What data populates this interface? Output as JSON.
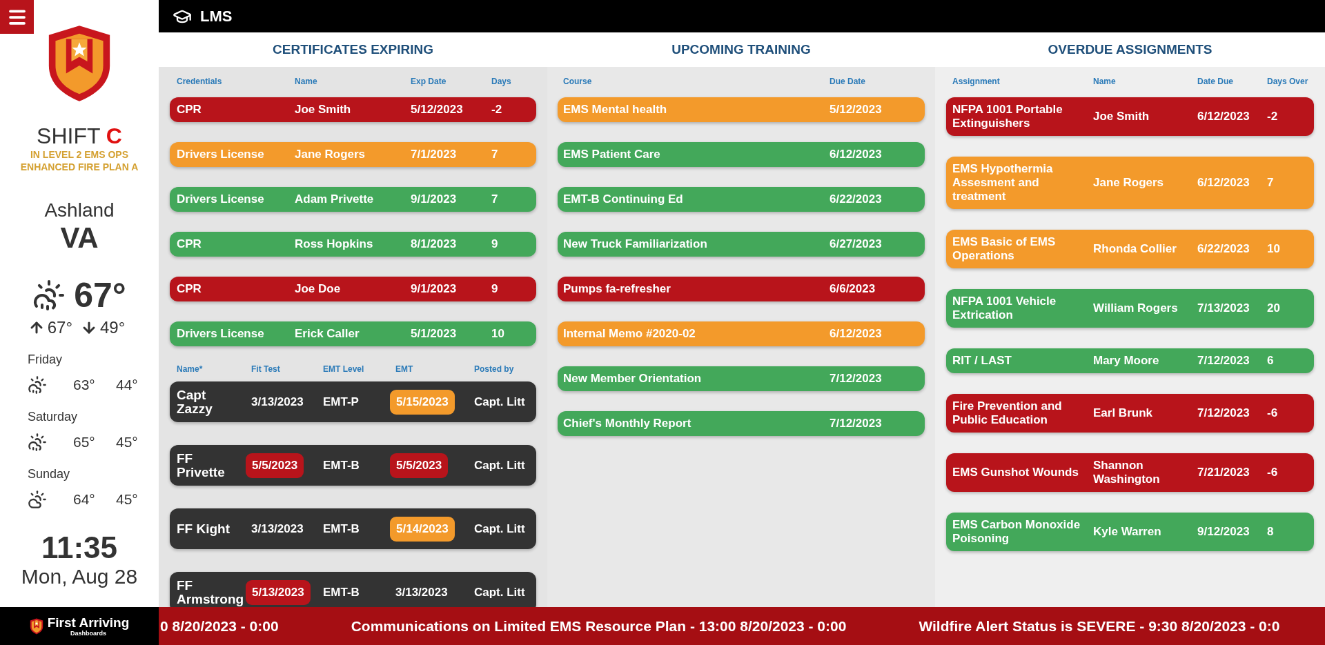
{
  "sidebar": {
    "shift": {
      "label": "SHIFT",
      "letter": "C"
    },
    "alert_lines": [
      "IN LEVEL 2 EMS OPS",
      "ENHANCED FIRE PLAN A"
    ],
    "city": "Ashland",
    "state": "VA",
    "weather": {
      "temperature": "67°",
      "high": "67°",
      "low": "49°"
    },
    "forecast": [
      {
        "day": "Friday",
        "kind": "rain",
        "high": "63°",
        "low": "44°"
      },
      {
        "day": "Saturday",
        "kind": "rain",
        "high": "65°",
        "low": "45°"
      },
      {
        "day": "Sunday",
        "kind": "cloudy",
        "high": "64°",
        "low": "45°"
      }
    ],
    "clock": {
      "time": "11:35",
      "date": "Mon, Aug 28"
    }
  },
  "header": {
    "title": "LMS"
  },
  "certificates": {
    "title": "CERTIFICATES EXPIRING",
    "columns": [
      "Credentials",
      "Name",
      "Exp Date",
      "Days"
    ],
    "rows": [
      {
        "color": "#b8141b",
        "cells": [
          "CPR",
          "Joe Smith",
          "5/12/2023",
          "-2"
        ]
      },
      {
        "color": "#f39a2b",
        "cells": [
          "Drivers License",
          "Jane Rogers",
          "7/1/2023",
          "7"
        ]
      },
      {
        "color": "#43a85a",
        "cells": [
          "Drivers License",
          "Adam Privette",
          "9/1/2023",
          "7"
        ]
      },
      {
        "color": "#43a85a",
        "cells": [
          "CPR",
          "Ross Hopkins",
          "8/1/2023",
          "9"
        ]
      },
      {
        "color": "#b8141b",
        "cells": [
          "CPR",
          "Joe Doe",
          "9/1/2023",
          "9"
        ]
      },
      {
        "color": "#43a85a",
        "cells": [
          "Drivers License",
          "Erick Caller",
          "5/1/2023",
          "10"
        ]
      }
    ]
  },
  "crew": {
    "columns": [
      "Name*",
      "Fit Test",
      "EMT Level",
      "EMT",
      "Posted by"
    ],
    "rows": [
      {
        "cells": [
          {
            "text": "Capt Zazzy"
          },
          {
            "text": "3/13/2023"
          },
          {
            "text": "EMT-P"
          },
          {
            "text": "5/15/2023",
            "color": "#f39a2b"
          },
          {
            "text": "Capt. Litt"
          }
        ]
      },
      {
        "cells": [
          {
            "text": "FF Privette"
          },
          {
            "text": "5/5/2023",
            "color": "#b8141b"
          },
          {
            "text": "EMT-B"
          },
          {
            "text": "5/5/2023",
            "color": "#b8141b"
          },
          {
            "text": "Capt. Litt"
          }
        ]
      },
      {
        "cells": [
          {
            "text": "FF Kight"
          },
          {
            "text": "3/13/2023"
          },
          {
            "text": "EMT-B"
          },
          {
            "text": "5/14/2023",
            "color": "#f39a2b"
          },
          {
            "text": "Capt. Litt"
          }
        ]
      },
      {
        "cells": [
          {
            "text": "FF Armstrong"
          },
          {
            "text": "5/13/2023",
            "color": "#b8141b"
          },
          {
            "text": "EMT-B"
          },
          {
            "text": "3/13/2023"
          },
          {
            "text": "Capt. Litt"
          }
        ]
      }
    ]
  },
  "training": {
    "title": "UPCOMING TRAINING",
    "columns": [
      "Course",
      "Due Date"
    ],
    "rows": [
      {
        "color": "#f39a2b",
        "cells": [
          "EMS Mental health",
          "5/12/2023"
        ]
      },
      {
        "color": "#43a85a",
        "cells": [
          "EMS Patient Care",
          "6/12/2023"
        ]
      },
      {
        "color": "#43a85a",
        "cells": [
          "EMT-B Continuing Ed",
          "6/22/2023"
        ]
      },
      {
        "color": "#43a85a",
        "cells": [
          "New Truck Familiarization",
          "6/27/2023"
        ]
      },
      {
        "color": "#b8141b",
        "cells": [
          "Pumps fa-refresher",
          "6/6/2023"
        ]
      },
      {
        "color": "#f39a2b",
        "cells": [
          "Internal Memo #2020-02",
          "6/12/2023"
        ]
      },
      {
        "color": "#43a85a",
        "cells": [
          "New Member Orientation",
          "7/12/2023"
        ]
      },
      {
        "color": "#43a85a",
        "cells": [
          "Chief's Monthly Report",
          "7/12/2023"
        ]
      }
    ]
  },
  "overdue": {
    "title": "OVERDUE ASSIGNMENTS",
    "columns": [
      "Assignment",
      "Name",
      "Date Due",
      "Days Over"
    ],
    "rows": [
      {
        "color": "#b8141b",
        "cells": [
          "NFPA 1001 Portable Extinguishers",
          "Joe Smith",
          "6/12/2023",
          "-2"
        ]
      },
      {
        "color": "#f39a2b",
        "cells": [
          "EMS Hypothermia Assesment and treatment",
          "Jane Rogers",
          "6/12/2023",
          "7"
        ]
      },
      {
        "color": "#f39a2b",
        "cells": [
          "EMS Basic of EMS Operations",
          "Rhonda Collier",
          "6/22/2023",
          "10"
        ]
      },
      {
        "color": "#43a85a",
        "cells": [
          "NFPA 1001 Vehicle Extrication",
          "William Rogers",
          "7/13/2023",
          "20"
        ]
      },
      {
        "color": "#43a85a",
        "cells": [
          "RIT / LAST",
          "Mary Moore",
          "7/12/2023",
          "6"
        ]
      },
      {
        "color": "#b8141b",
        "cells": [
          "Fire Prevention and Public Education",
          "Earl Brunk",
          "7/12/2023",
          "-6"
        ]
      },
      {
        "color": "#b8141b",
        "cells": [
          "EMS Gunshot Wounds",
          "Shannon Washington",
          "7/21/2023",
          "-6"
        ]
      },
      {
        "color": "#43a85a",
        "cells": [
          "EMS Carbon Monoxide Poisoning",
          "Kyle Warren",
          "9/12/2023",
          "8"
        ]
      }
    ]
  },
  "footer": {
    "brand": "First Arriving",
    "tagline": "Dashboards",
    "ticker": [
      "0 8/20/2023 - 0:00",
      "Communications on Limited EMS Resource Plan - 13:00 8/20/2023 - 0:00",
      "Wildfire Alert Status is SEVERE - 9:30 8/20/2023 - 0:0"
    ]
  }
}
